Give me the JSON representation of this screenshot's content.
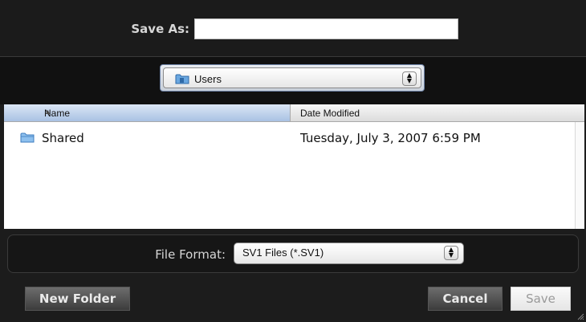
{
  "save_as": {
    "label": "Save As:",
    "value": "",
    "placeholder": ""
  },
  "location": {
    "selected": "Users",
    "icon": "folder-icon"
  },
  "browser": {
    "columns": {
      "name": "Name",
      "date_modified": "Date Modified",
      "sort": "ascending"
    },
    "rows": [
      {
        "name": "Shared",
        "date_modified": "Tuesday, July 3, 2007 6:59 PM",
        "icon": "folder-icon"
      }
    ]
  },
  "file_format": {
    "label": "File Format:",
    "selected": "SV1 Files (*.SV1)"
  },
  "buttons": {
    "new_folder": "New Folder",
    "cancel": "Cancel",
    "save": "Save"
  },
  "colors": {
    "background": "#1c1c1c",
    "header_selected": "#a9c2e3",
    "save_disabled_text": "#9a9a9a"
  }
}
